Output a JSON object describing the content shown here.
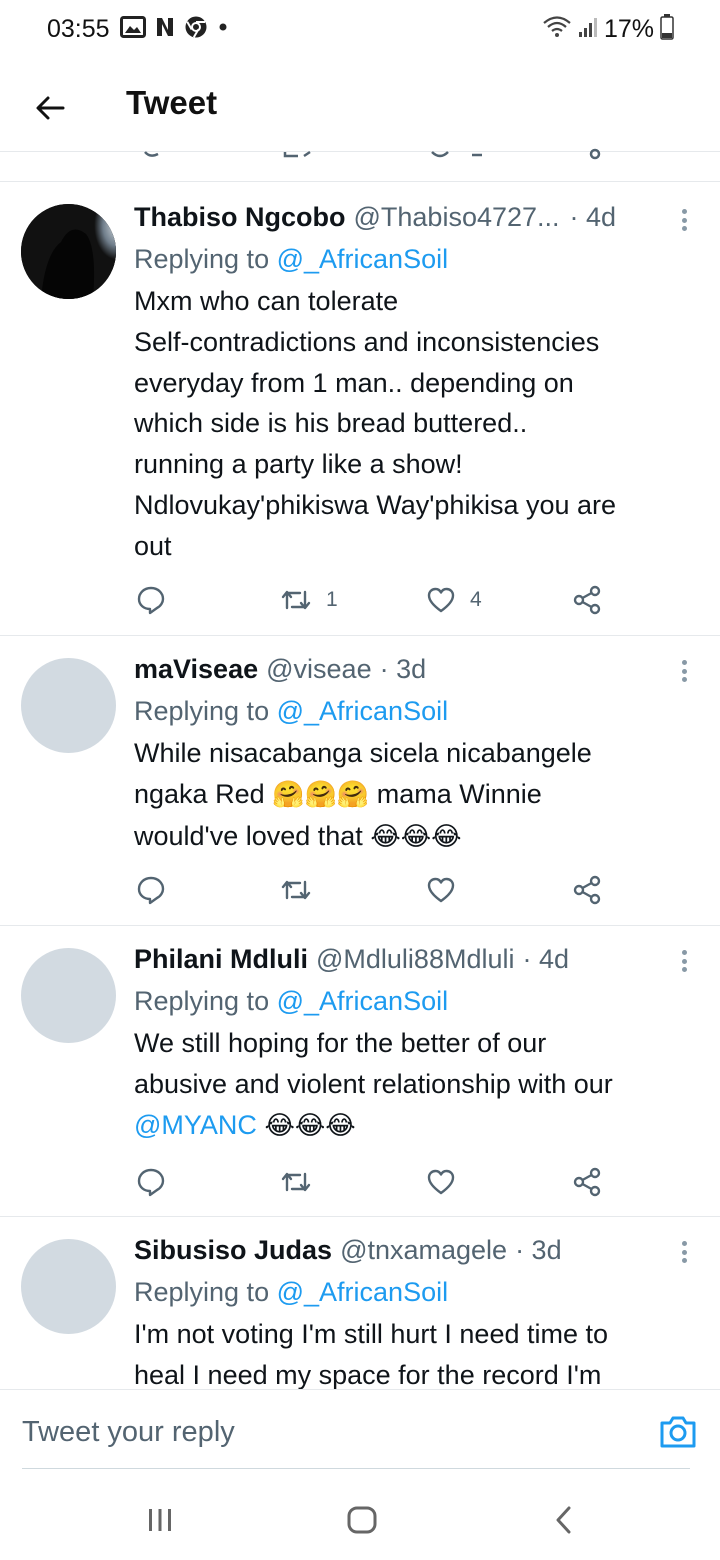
{
  "status_bar": {
    "time": "03:55",
    "battery_percent": "17%",
    "icons": [
      "gallery-icon",
      "netflix-icon",
      "chrome-icon",
      "dot-icon",
      "wifi-icon",
      "signal-icon",
      "battery-icon"
    ]
  },
  "header": {
    "title": "Tweet",
    "back_icon": "back-arrow-icon"
  },
  "tweets": [
    {
      "name": "Thabiso Ngcobo",
      "handle": "@Thabiso4727...",
      "time": "· 4d",
      "replying_prefix": "Replying to",
      "replying_to": "@_AfricanSoil",
      "lines": [
        "Mxm who can tolerate",
        "Self-contradictions and inconsistencies",
        "everyday from 1 man.. depending on",
        "which side is his bread buttered..",
        "running a party like a show!",
        "Ndlovukay'phikiswa Way'phikisa you are",
        "out"
      ],
      "retweet_count": "1",
      "like_count": "4"
    },
    {
      "name": "maViseae",
      "handle": "@viseae",
      "time": "· 3d",
      "replying_prefix": "Replying to",
      "replying_to": "@_AfricanSoil",
      "line1": "While nisacabanga sicela nicabangele",
      "line2_a": "ngaka Red",
      "line2_emoji": "🤗🤗🤗",
      "line2_b": "mama Winnie",
      "line3_a": "would've loved that",
      "line3_emoji": "😂😂😂",
      "retweet_count": "",
      "like_count": ""
    },
    {
      "name": "Philani Mdluli",
      "handle": "@Mdluli88Mdluli",
      "time": "· 4d",
      "replying_prefix": "Replying to",
      "replying_to": "@_AfricanSoil",
      "line1": "We still hoping for the better of our",
      "line2": "abusive and violent relationship with our",
      "line3_link": "@MYANC",
      "line3_emoji": "😂😂😂",
      "retweet_count": "",
      "like_count": ""
    },
    {
      "name": "Sibusiso Judas",
      "handle": "@tnxamagele",
      "time": "· 3d",
      "replying_prefix": "Replying to",
      "replying_to": "@_AfricanSoil",
      "lines": [
        "I'm not voting I'm still hurt I need time to",
        "heal I need my space for the record I'm"
      ]
    }
  ],
  "reply_bar": {
    "placeholder": "Tweet your reply",
    "camera_icon": "camera-icon"
  },
  "nav_bar": {
    "icons": [
      "recents-icon",
      "home-icon",
      "back-icon"
    ]
  },
  "colors": {
    "accent": "#1d9bf0",
    "secondary_text": "#536471",
    "divider": "#e6e9ec",
    "avatar_placeholder": "#d2dae1"
  }
}
